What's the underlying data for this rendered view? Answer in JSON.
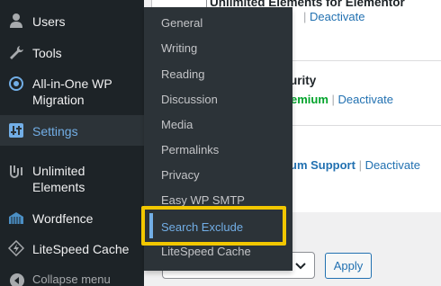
{
  "sidebar": {
    "items": [
      {
        "label": "Users",
        "icon": "users-icon"
      },
      {
        "label": "Tools",
        "icon": "wrench-icon"
      },
      {
        "label": "All-in-One WP Migration",
        "icon": "migration-icon"
      },
      {
        "label": "Settings",
        "icon": "settings-sliders-icon"
      },
      {
        "label": "Unlimited Elements",
        "icon": "unlimited-elements-icon"
      },
      {
        "label": "Wordfence",
        "icon": "wordfence-icon"
      },
      {
        "label": "LiteSpeed Cache",
        "icon": "litespeed-icon"
      }
    ],
    "collapse_label": "Collapse menu",
    "all_in_one_line1": "All-in-One WP",
    "all_in_one_line2": "Migration",
    "unlimited_line1": "Unlimited",
    "unlimited_line2": "Elements"
  },
  "flyout": {
    "items": [
      "General",
      "Writing",
      "Reading",
      "Discussion",
      "Media",
      "Permalinks",
      "Privacy",
      "Easy WP SMTP",
      "Search Exclude",
      "LiteSpeed Cache"
    ],
    "selected": "Search Exclude"
  },
  "plugins": {
    "row1": {
      "title": "Unlimited Elements for Elementor",
      "action": "Deactivate"
    },
    "row2": {
      "title_fragment": "urity",
      "premium": "emium",
      "action": "Deactivate"
    },
    "row3": {
      "support": "um Support",
      "action": "Deactivate"
    }
  },
  "bulk": {
    "apply_label": "Apply"
  },
  "colors": {
    "sidebar_bg": "#1d2327",
    "flyout_bg": "#2c3338",
    "accent": "#72aee6",
    "highlight": "#f2c700",
    "link": "#2271b1",
    "premium": "#00a32a"
  }
}
